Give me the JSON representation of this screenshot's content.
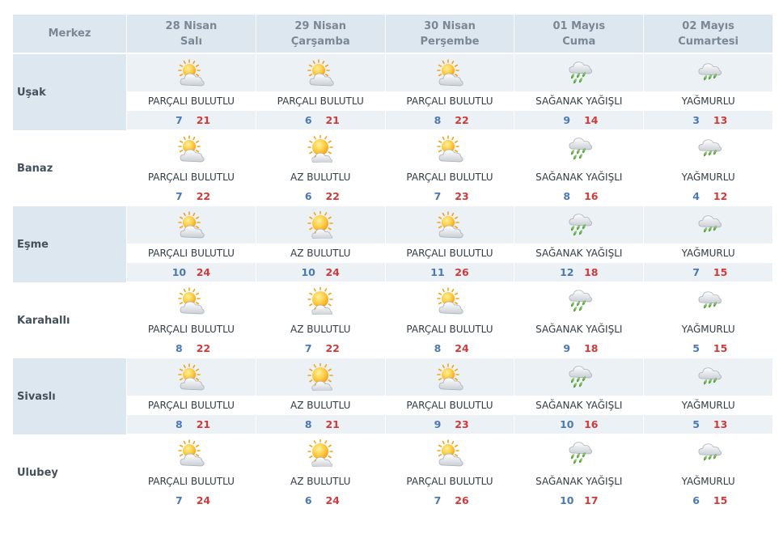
{
  "header": {
    "city_col": "Merkez",
    "days": [
      {
        "date": "28 Nisan",
        "weekday": "Salı"
      },
      {
        "date": "29 Nisan",
        "weekday": "Çarşamba"
      },
      {
        "date": "30 Nisan",
        "weekday": "Perşembe"
      },
      {
        "date": "01 Mayıs",
        "weekday": "Cuma"
      },
      {
        "date": "02 Mayıs",
        "weekday": "Cumartesi"
      }
    ]
  },
  "rows": [
    {
      "city": "Uşak",
      "days": [
        {
          "icon": "partly-cloudy-icon",
          "desc": "PARÇALI BULUTLU",
          "low": "7",
          "high": "21"
        },
        {
          "icon": "partly-cloudy-icon",
          "desc": "PARÇALI BULUTLU",
          "low": "6",
          "high": "21"
        },
        {
          "icon": "partly-cloudy-icon",
          "desc": "PARÇALI BULUTLU",
          "low": "8",
          "high": "22"
        },
        {
          "icon": "heavy-rain-icon",
          "desc": "SAĞANAK YAĞIŞLI",
          "low": "9",
          "high": "14"
        },
        {
          "icon": "rain-icon",
          "desc": "YAĞMURLU",
          "low": "3",
          "high": "13"
        }
      ]
    },
    {
      "city": "Banaz",
      "days": [
        {
          "icon": "partly-cloudy-icon",
          "desc": "PARÇALI BULUTLU",
          "low": "7",
          "high": "22"
        },
        {
          "icon": "mostly-sunny-icon",
          "desc": "AZ BULUTLU",
          "low": "6",
          "high": "22"
        },
        {
          "icon": "partly-cloudy-icon",
          "desc": "PARÇALI BULUTLU",
          "low": "7",
          "high": "23"
        },
        {
          "icon": "heavy-rain-icon",
          "desc": "SAĞANAK YAĞIŞLI",
          "low": "8",
          "high": "16"
        },
        {
          "icon": "rain-icon",
          "desc": "YAĞMURLU",
          "low": "4",
          "high": "12"
        }
      ]
    },
    {
      "city": "Eşme",
      "days": [
        {
          "icon": "partly-cloudy-icon",
          "desc": "PARÇALI BULUTLU",
          "low": "10",
          "high": "24"
        },
        {
          "icon": "mostly-sunny-icon",
          "desc": "AZ BULUTLU",
          "low": "10",
          "high": "24"
        },
        {
          "icon": "partly-cloudy-icon",
          "desc": "PARÇALI BULUTLU",
          "low": "11",
          "high": "26"
        },
        {
          "icon": "heavy-rain-icon",
          "desc": "SAĞANAK YAĞIŞLI",
          "low": "12",
          "high": "18"
        },
        {
          "icon": "rain-icon",
          "desc": "YAĞMURLU",
          "low": "7",
          "high": "15"
        }
      ]
    },
    {
      "city": "Karahallı",
      "days": [
        {
          "icon": "partly-cloudy-icon",
          "desc": "PARÇALI BULUTLU",
          "low": "8",
          "high": "22"
        },
        {
          "icon": "mostly-sunny-icon",
          "desc": "AZ BULUTLU",
          "low": "7",
          "high": "22"
        },
        {
          "icon": "partly-cloudy-icon",
          "desc": "PARÇALI BULUTLU",
          "low": "8",
          "high": "24"
        },
        {
          "icon": "heavy-rain-icon",
          "desc": "SAĞANAK YAĞIŞLI",
          "low": "9",
          "high": "18"
        },
        {
          "icon": "rain-icon",
          "desc": "YAĞMURLU",
          "low": "5",
          "high": "15"
        }
      ]
    },
    {
      "city": "Sivaslı",
      "days": [
        {
          "icon": "partly-cloudy-icon",
          "desc": "PARÇALI BULUTLU",
          "low": "8",
          "high": "21"
        },
        {
          "icon": "mostly-sunny-icon",
          "desc": "AZ BULUTLU",
          "low": "8",
          "high": "21"
        },
        {
          "icon": "partly-cloudy-icon",
          "desc": "PARÇALI BULUTLU",
          "low": "9",
          "high": "23"
        },
        {
          "icon": "heavy-rain-icon",
          "desc": "SAĞANAK YAĞIŞLI",
          "low": "10",
          "high": "16"
        },
        {
          "icon": "rain-icon",
          "desc": "YAĞMURLU",
          "low": "5",
          "high": "13"
        }
      ]
    },
    {
      "city": "Ulubey",
      "days": [
        {
          "icon": "partly-cloudy-icon",
          "desc": "PARÇALI BULUTLU",
          "low": "7",
          "high": "24"
        },
        {
          "icon": "mostly-sunny-icon",
          "desc": "AZ BULUTLU",
          "low": "6",
          "high": "24"
        },
        {
          "icon": "partly-cloudy-icon",
          "desc": "PARÇALI BULUTLU",
          "low": "7",
          "high": "26"
        },
        {
          "icon": "heavy-rain-icon",
          "desc": "SAĞANAK YAĞIŞLI",
          "low": "10",
          "high": "17"
        },
        {
          "icon": "rain-icon",
          "desc": "YAĞMURLU",
          "low": "6",
          "high": "15"
        }
      ]
    }
  ],
  "colors": {
    "header_bg": "#dde7ef",
    "shaded_row_bg": "#ebf1f5",
    "low_temp": "#4a79b5",
    "high_temp": "#d03a3a"
  }
}
